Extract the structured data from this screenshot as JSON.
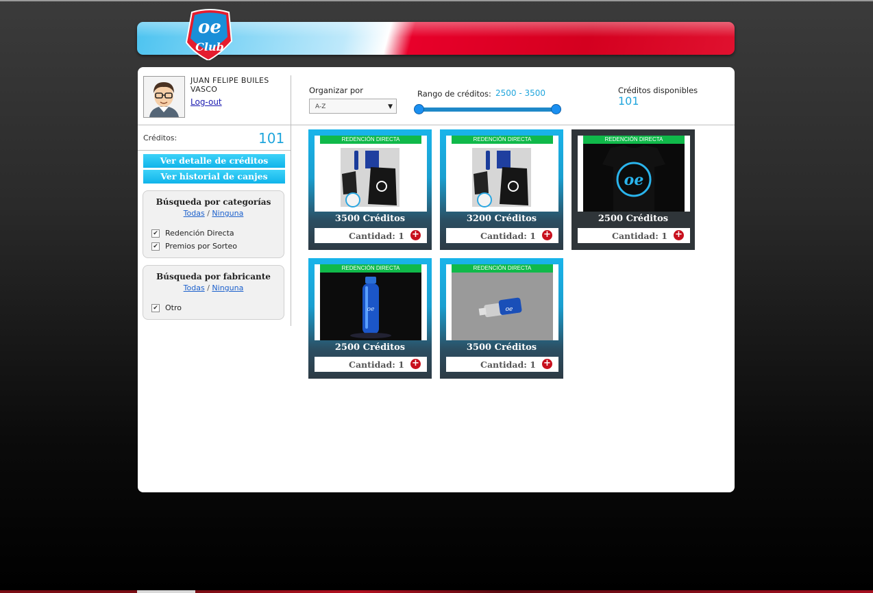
{
  "user": {
    "name": "JUAN FELIPE BUILES VASCO",
    "logout": "Log-out"
  },
  "sidebar": {
    "credits_label": "Créditos:",
    "credits_value": "101",
    "btn_detail": "Ver detalle de créditos",
    "btn_history": "Ver historial de canjes",
    "categories": {
      "title": "Búsqueda por categorías",
      "all": "Todas",
      "sep": "/",
      "none": "Ninguna",
      "items": [
        "Redención Directa",
        "Premios por Sorteo"
      ]
    },
    "makers": {
      "title": "Búsqueda por fabricante",
      "all": "Todas",
      "sep": "/",
      "none": "Ninguna",
      "items": [
        "Otro"
      ]
    }
  },
  "filters": {
    "sort_label": "Organizar por",
    "sort_value": "A-Z",
    "range_label": "Rango de créditos:",
    "range_value": "2500 - 3500",
    "available_label": "Créditos disponibles",
    "available_value": "101"
  },
  "products": [
    {
      "ribbon": "REDENCIÓN DIRECTA",
      "price": "3500 Créditos",
      "qty": "Cantidad: 1",
      "plus": "+"
    },
    {
      "ribbon": "REDENCIÓN DIRECTA",
      "price": "3200 Créditos",
      "qty": "Cantidad: 1",
      "plus": "+"
    },
    {
      "ribbon": "REDENCIÓN DIRECTA",
      "price": "2500 Créditos",
      "qty": "Cantidad: 1",
      "plus": "+"
    },
    {
      "ribbon": "REDENCIÓN DIRECTA",
      "price": "2500 Créditos",
      "qty": "Cantidad: 1",
      "plus": "+"
    },
    {
      "ribbon": "REDENCIÓN DIRECTA",
      "price": "3500 Créditos",
      "qty": "Cantidad: 1",
      "plus": "+"
    }
  ],
  "colors": {
    "accent": "#1fa5dc",
    "banner_red": "#e0112f",
    "ribbon_green": "#10b94a"
  }
}
